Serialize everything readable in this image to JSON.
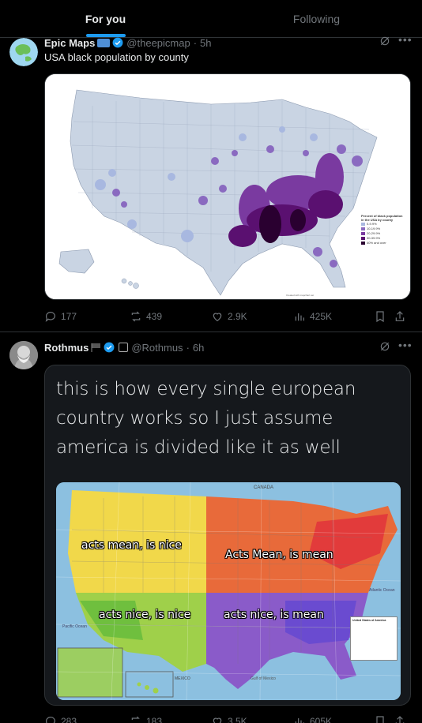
{
  "tabs": [
    {
      "label": "For you",
      "active": true
    },
    {
      "label": "Following",
      "active": false
    }
  ],
  "post1": {
    "name": "Epic Maps",
    "handle": "@theepicmap",
    "time": "5h",
    "text": "USA black population by county",
    "map_legend": {
      "title": "Percent of black population in the USA by county",
      "items": [
        "0-9.9%",
        "10-19.9%",
        "20-29.9%",
        "30-39.9%",
        "40% and over"
      ],
      "colors": [
        "#a8b8e0",
        "#8a6ac0",
        "#7a3aa0",
        "#5a1070",
        "#2a0030"
      ]
    },
    "map_credit": "Created with mapchart.net",
    "stats": {
      "replies": "177",
      "reposts": "439",
      "likes": "2.9K",
      "views": "425K"
    }
  },
  "post2": {
    "name": "Rothmus",
    "handle": "@Rothmus",
    "time": "6h",
    "meme_text": "this is how every single european country works so I just assume america is divided like it as well",
    "map_labels": {
      "nw": "acts mean, is nice",
      "ne": "Acts Mean, is mean",
      "sw": "acts nice, is nice",
      "se": "acts nice, is mean",
      "canada": "CANADA",
      "mexico": "MEXICO",
      "gulf": "Gulf of Mexico",
      "pacific": "Pacific Ocean",
      "atlantic": "Atlantic Ocean",
      "legend_title": "United States of America"
    },
    "stats": {
      "replies": "283",
      "reposts": "183",
      "likes": "3.5K",
      "views": "605K"
    }
  },
  "colors": {
    "accent": "#1d9bf0",
    "muted": "#71767b",
    "text": "#e7e9ea",
    "border": "#2f3336"
  }
}
